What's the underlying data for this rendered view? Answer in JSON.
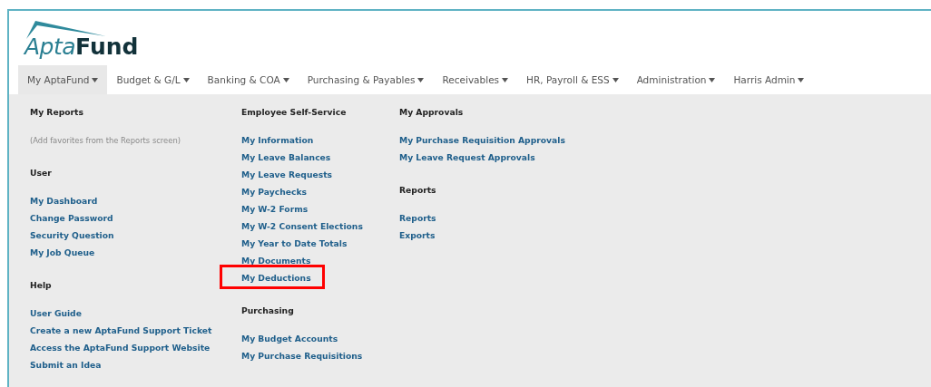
{
  "logo": {
    "part_1": "Apta",
    "part_2": "Fund"
  },
  "nav": [
    {
      "label": "My AptaFund",
      "selected": true
    },
    {
      "label": "Budget & G/L",
      "selected": false
    },
    {
      "label": "Banking & COA",
      "selected": false
    },
    {
      "label": "Purchasing & Payables",
      "selected": false
    },
    {
      "label": "Receivables",
      "selected": false
    },
    {
      "label": "HR, Payroll & ESS",
      "selected": false
    },
    {
      "label": "Administration",
      "selected": false
    },
    {
      "label": "Harris Admin",
      "selected": false
    }
  ],
  "menu_columns": [
    [
      {
        "heading": "My Reports",
        "items": [
          {
            "label": "(Add favorites from the Reports screen)",
            "kind": "note",
            "highlighted": false
          }
        ]
      },
      {
        "heading": "User",
        "items": [
          {
            "label": "My Dashboard",
            "kind": "link",
            "highlighted": false
          },
          {
            "label": "Change Password",
            "kind": "link",
            "highlighted": false
          },
          {
            "label": "Security Question",
            "kind": "link",
            "highlighted": false
          },
          {
            "label": "My Job Queue",
            "kind": "link",
            "highlighted": false
          }
        ]
      },
      {
        "heading": "Help",
        "items": [
          {
            "label": "User Guide",
            "kind": "link",
            "highlighted": false
          },
          {
            "label": "Create a new AptaFund Support Ticket",
            "kind": "link",
            "highlighted": false
          },
          {
            "label": "Access the AptaFund Support Website",
            "kind": "link",
            "highlighted": false
          },
          {
            "label": "Submit an Idea",
            "kind": "link",
            "highlighted": false
          }
        ]
      }
    ],
    [
      {
        "heading": "Employee Self-Service",
        "items": [
          {
            "label": "My Information",
            "kind": "link",
            "highlighted": false
          },
          {
            "label": "My Leave Balances",
            "kind": "link",
            "highlighted": false
          },
          {
            "label": "My Leave Requests",
            "kind": "link",
            "highlighted": false
          },
          {
            "label": "My Paychecks",
            "kind": "link",
            "highlighted": false
          },
          {
            "label": "My W-2 Forms",
            "kind": "link",
            "highlighted": false
          },
          {
            "label": "My W-2 Consent Elections",
            "kind": "link",
            "highlighted": false
          },
          {
            "label": "My Year to Date Totals",
            "kind": "link",
            "highlighted": false
          },
          {
            "label": "My Documents",
            "kind": "link",
            "highlighted": false
          },
          {
            "label": "My Deductions",
            "kind": "link",
            "highlighted": true
          }
        ]
      },
      {
        "heading": "Purchasing",
        "items": [
          {
            "label": "My Budget Accounts",
            "kind": "link",
            "highlighted": false
          },
          {
            "label": "My Purchase Requisitions",
            "kind": "link",
            "highlighted": false
          }
        ]
      }
    ],
    [
      {
        "heading": "My Approvals",
        "items": [
          {
            "label": "My Purchase Requisition Approvals",
            "kind": "link",
            "highlighted": false
          },
          {
            "label": "My Leave Request Approvals",
            "kind": "link",
            "highlighted": false
          }
        ]
      },
      {
        "heading": "Reports",
        "items": [
          {
            "label": "Reports",
            "kind": "link",
            "highlighted": false
          },
          {
            "label": "Exports",
            "kind": "link",
            "highlighted": false
          }
        ]
      }
    ]
  ]
}
